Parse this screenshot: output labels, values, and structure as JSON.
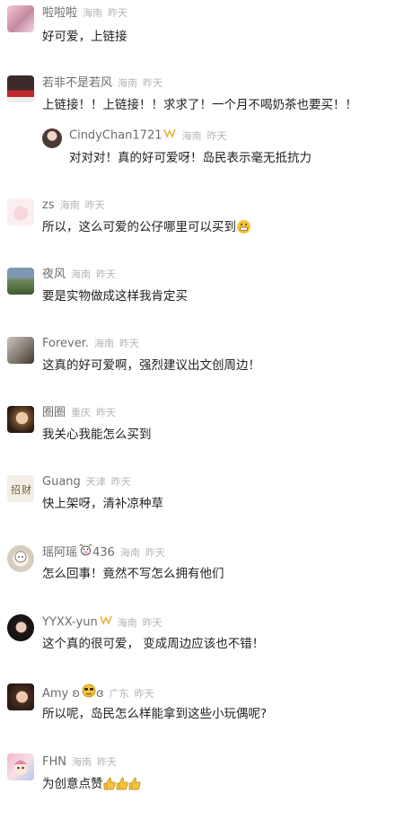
{
  "comments": [
    {
      "name": "啦啦啦",
      "location": "海南",
      "time": "昨天",
      "text": "好可爱，上链接"
    },
    {
      "name": "若非不是若风",
      "location": "海南",
      "time": "昨天",
      "text": "上链接！！上链接！！求求了！一个月不喝奶茶也要买！！",
      "reply": {
        "name": "CindyChan1721",
        "location": "海南",
        "time": "昨天",
        "text": "对对对！真的好可爱呀！岛民表示毫无抵抗力"
      }
    },
    {
      "name": "zs",
      "location": "海南",
      "time": "昨天",
      "text": "所以，这么可爱的公仔哪里可以买到"
    },
    {
      "name": "夜风",
      "location": "海南",
      "time": "昨天",
      "text": "要是实物做成这样我肯定买"
    },
    {
      "name": "Forever.",
      "location": "海南",
      "time": "昨天",
      "text": "这真的好可爱啊，强烈建议出文创周边！"
    },
    {
      "name": "圈圈",
      "location": "重庆",
      "time": "昨天",
      "text": "我关心我能怎么买到"
    },
    {
      "name": "Guang",
      "location": "天津",
      "time": "昨天",
      "text": "快上架呀，清补凉种草"
    },
    {
      "name": "瑶阿瑶",
      "name_suffix": "436",
      "location": "海南",
      "time": "昨天",
      "text": "怎么回事！竟然不写怎么拥有他们"
    },
    {
      "name": "YYXX-yun",
      "location": "海南",
      "time": "昨天",
      "text": "这个真的很可爱， 变成周边应该也不错！"
    },
    {
      "name": "Amy ʚ",
      "name_suffix": "ɞ",
      "location": "广东",
      "time": "昨天",
      "text": "所以呢，岛民怎么样能拿到这些小玩偶呢?"
    },
    {
      "name": "FHN",
      "location": "海南",
      "time": "昨天",
      "text": "为创意点赞"
    }
  ],
  "icons": {
    "badge": "gold-vip-badge-icon",
    "grin": "grinning-emoji-icon",
    "thumb": "thumbs-up-emoji-icon",
    "cow": "cow-emoji-icon",
    "face": "heart-eyes-emoji-icon"
  }
}
